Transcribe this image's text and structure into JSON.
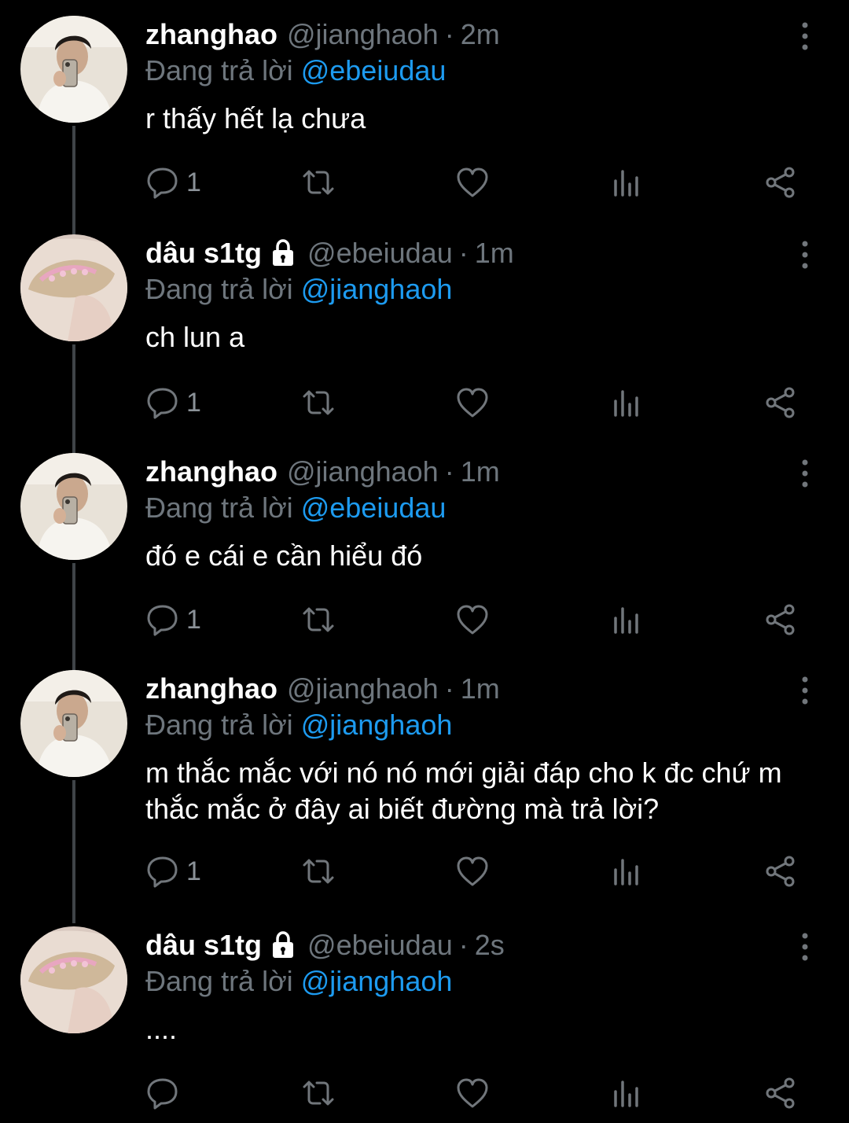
{
  "tweets": [
    {
      "name": "zhanghao",
      "handle": "@jianghaoh",
      "time": "2m",
      "replying_prefix": "Đang trả lời",
      "replying_to": "@ebeiudau",
      "text": "r thấy hết lạ chưa",
      "reply_count": "1",
      "protected": false,
      "avatar": "photo-boy-mirror-selfie"
    },
    {
      "name": "dâu s1tg",
      "handle": "@ebeiudau",
      "time": "1m",
      "replying_prefix": "Đang trả lời",
      "replying_to": "@jianghaoh",
      "text": "ch lun a",
      "reply_count": "1",
      "protected": true,
      "avatar": "photo-hair-clip"
    },
    {
      "name": "zhanghao",
      "handle": "@jianghaoh",
      "time": "1m",
      "replying_prefix": "Đang trả lời",
      "replying_to": "@ebeiudau",
      "text": "đó e cái e cần hiểu đó",
      "reply_count": "1",
      "protected": false,
      "avatar": "photo-boy-mirror-selfie"
    },
    {
      "name": "zhanghao",
      "handle": "@jianghaoh",
      "time": "1m",
      "replying_prefix": "Đang trả lời",
      "replying_to": "@jianghaoh",
      "text": "m thắc mắc với nó nó mới giải đáp cho k đc chứ m thắc mắc ở đây ai biết đường mà trả lời?",
      "reply_count": "1",
      "protected": false,
      "avatar": "photo-boy-mirror-selfie"
    },
    {
      "name": "dâu s1tg",
      "handle": "@ebeiudau",
      "time": "2s",
      "replying_prefix": "Đang trả lời",
      "replying_to": "@jianghaoh",
      "text": "....",
      "reply_count": "",
      "protected": true,
      "avatar": "photo-hair-clip"
    }
  ],
  "separator": "·",
  "icons": {
    "reply": "reply-icon",
    "retweet": "retweet-icon",
    "like": "like-icon",
    "views": "views-icon",
    "share": "share-icon",
    "more": "more-options-icon",
    "lock": "lock-icon"
  },
  "colors": {
    "background": "#000000",
    "text": "#ffffff",
    "secondary": "#6e767d",
    "link": "#1d9bf0",
    "thread_line": "#3f4448"
  }
}
